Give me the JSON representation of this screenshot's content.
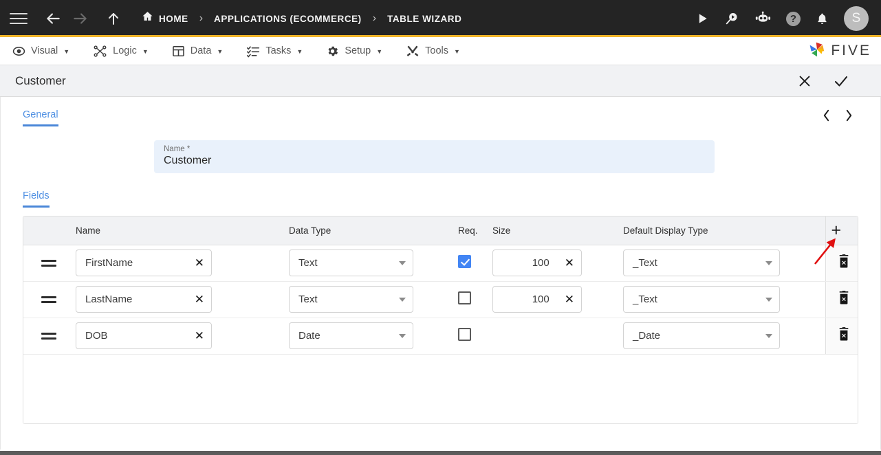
{
  "topbar": {
    "menu_icon": "hamburger-icon",
    "back_icon": "arrow-left-icon",
    "forward_icon": "arrow-right-icon",
    "up_icon": "arrow-up-icon",
    "breadcrumbs": [
      {
        "label": "HOME",
        "icon": "home-icon"
      },
      {
        "label": "APPLICATIONS (ECOMMERCE)",
        "icon": ""
      },
      {
        "label": "TABLE WIZARD",
        "icon": ""
      }
    ],
    "separator": "›",
    "actions": [
      {
        "name": "run-button",
        "icon": "play-icon"
      },
      {
        "name": "search-run-button",
        "icon": "search-play-icon"
      },
      {
        "name": "assistant-button",
        "icon": "robot-icon"
      },
      {
        "name": "help-button",
        "icon": "question-mark-icon",
        "glyph": "?"
      },
      {
        "name": "notifications-button",
        "icon": "bell-icon"
      }
    ],
    "avatar_initial": "S",
    "accent_color": "#f0b429",
    "background_color": "#242424"
  },
  "menubar": {
    "items": [
      {
        "label": "Visual",
        "icon": "eye-icon"
      },
      {
        "label": "Logic",
        "icon": "logic-nodes-icon"
      },
      {
        "label": "Data",
        "icon": "table-grid-icon"
      },
      {
        "label": "Tasks",
        "icon": "checklist-icon"
      },
      {
        "label": "Setup",
        "icon": "gear-icon"
      },
      {
        "label": "Tools",
        "icon": "wrench-screwdriver-icon"
      }
    ],
    "caret": "▼",
    "brand": {
      "text": "FIVE",
      "icon": "five-pinwheel-logo"
    }
  },
  "pagebar": {
    "title": "Customer",
    "cancel_icon": "close-x-icon",
    "confirm_icon": "checkmark-icon"
  },
  "tabs": {
    "general": "General",
    "prev_icon": "chevron-left-icon",
    "next_icon": "chevron-right-icon",
    "prev_glyph": "‹",
    "next_glyph": "›"
  },
  "name_field": {
    "label": "Name *",
    "value": "Customer"
  },
  "fields_section": {
    "tab_label": "Fields",
    "add_icon": "plus-icon",
    "add_glyph": "+",
    "delete_icon": "trash-icon",
    "drag_icon": "drag-handle-icon",
    "clear_glyph": "✕",
    "columns": [
      {
        "key": "handle",
        "label": ""
      },
      {
        "key": "name",
        "label": "Name"
      },
      {
        "key": "type",
        "label": "Data Type"
      },
      {
        "key": "req",
        "label": "Req."
      },
      {
        "key": "size",
        "label": "Size"
      },
      {
        "key": "display",
        "label": "Default Display Type"
      },
      {
        "key": "action",
        "label": ""
      }
    ],
    "rows": [
      {
        "name": "FirstName",
        "type": "Text",
        "required": true,
        "size": "100",
        "display": "_Text"
      },
      {
        "name": "LastName",
        "type": "Text",
        "required": false,
        "size": "100",
        "display": "_Text"
      },
      {
        "name": "DOB",
        "type": "Date",
        "required": false,
        "size": "",
        "display": "_Date"
      }
    ]
  },
  "annotation": {
    "type": "arrow",
    "color": "#e01010",
    "points_to": "add-field-button"
  },
  "theme": {
    "accent_blue": "#4a87d8",
    "checkbox_blue": "#4285f4",
    "field_bg": "#e9f1fb",
    "header_bg": "#f1f2f4"
  }
}
